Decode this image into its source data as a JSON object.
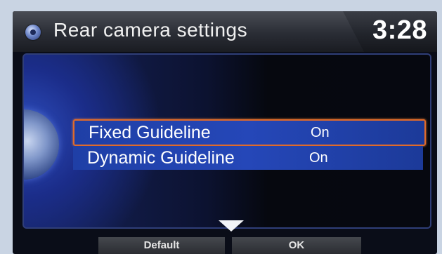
{
  "header": {
    "title": "Rear camera settings",
    "clock": "3:28",
    "icon": "settings-disc-icon"
  },
  "options": [
    {
      "label": "Fixed Guideline",
      "value": "On",
      "selected": true
    },
    {
      "label": "Dynamic Guideline",
      "value": "On",
      "selected": false
    }
  ],
  "footer": {
    "default_label": "Default",
    "ok_label": "OK",
    "scroll_icon": "scroll-down-arrow-icon"
  },
  "colors": {
    "selection_border": "#e06a2a",
    "row_fill": "#2547b8",
    "screen_bg": "#0a0d18"
  }
}
